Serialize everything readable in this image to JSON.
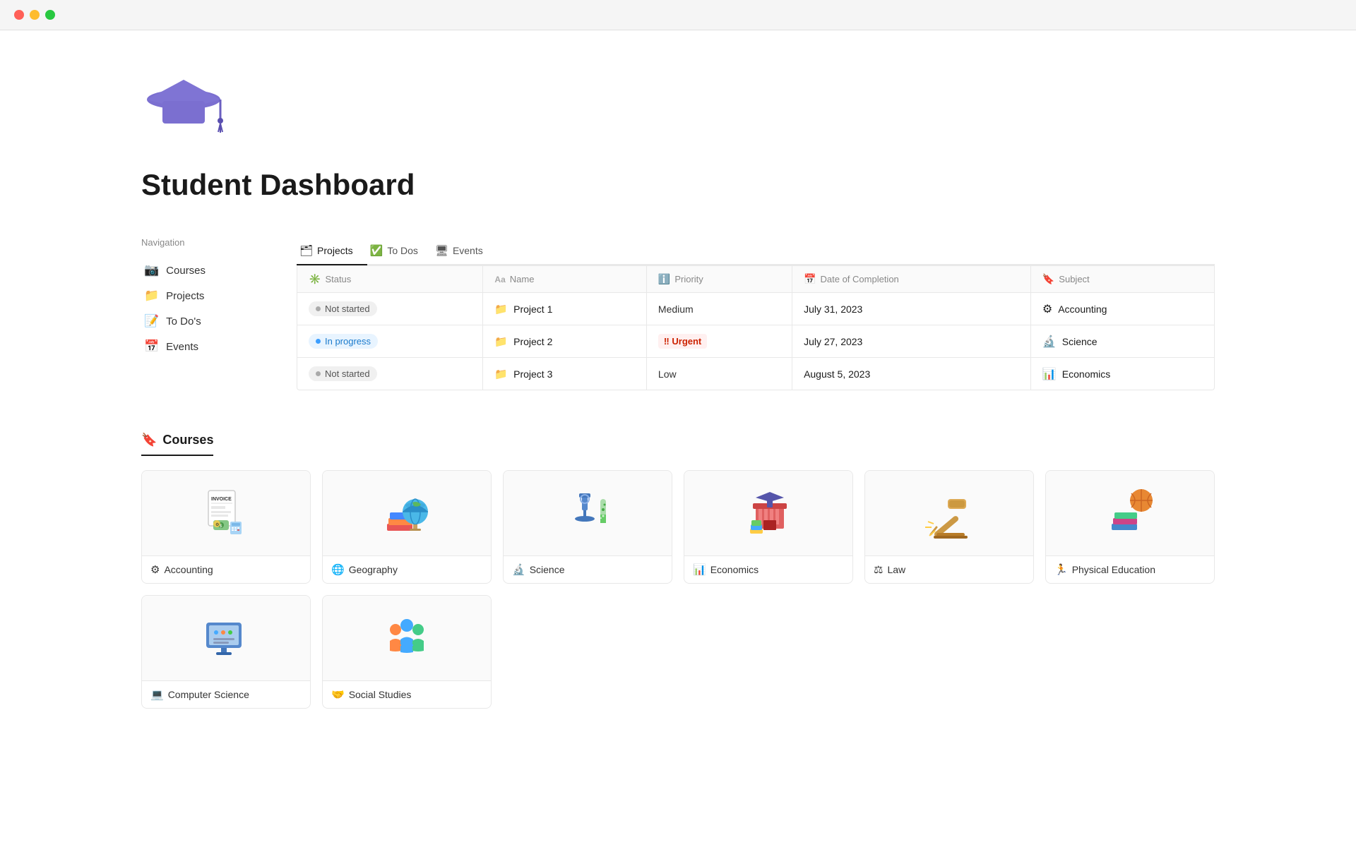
{
  "titleBar": {
    "buttons": [
      "red",
      "yellow",
      "green"
    ]
  },
  "header": {
    "logoAlt": "Graduation cap emoji",
    "title": "Student Dashboard"
  },
  "navigation": {
    "heading": "Navigation",
    "items": [
      {
        "id": "courses",
        "icon": "📷",
        "label": "Courses"
      },
      {
        "id": "projects",
        "icon": "📁",
        "label": "Projects"
      },
      {
        "id": "todos",
        "icon": "📝",
        "label": "To Do's"
      },
      {
        "id": "events",
        "icon": "📅",
        "label": "Events"
      }
    ]
  },
  "tabs": [
    {
      "id": "projects",
      "icon": "🗂",
      "label": "Projects",
      "active": true
    },
    {
      "id": "todos",
      "icon": "✅",
      "label": "To Dos",
      "active": false
    },
    {
      "id": "events",
      "icon": "🖥",
      "label": "Events",
      "active": false
    }
  ],
  "table": {
    "columns": [
      {
        "id": "status",
        "icon": "✳",
        "label": "Status"
      },
      {
        "id": "name",
        "icon": "Aa",
        "label": "Name"
      },
      {
        "id": "priority",
        "icon": "ℹ",
        "label": "Priority"
      },
      {
        "id": "dateCompletion",
        "icon": "📅",
        "label": "Date of Completion"
      },
      {
        "id": "subject",
        "icon": "🔖",
        "label": "Subject"
      }
    ],
    "rows": [
      {
        "status": "Not started",
        "statusType": "not-started",
        "name": "Project 1",
        "priority": "Medium",
        "priorityType": "medium",
        "date": "July 31, 2023",
        "subject": "Accounting",
        "subjectIcon": "⚙"
      },
      {
        "status": "In progress",
        "statusType": "in-progress",
        "name": "Project 2",
        "priority": "!! Urgent",
        "priorityType": "urgent",
        "date": "July 27, 2023",
        "subject": "Science",
        "subjectIcon": "🔬"
      },
      {
        "status": "Not started",
        "statusType": "not-started",
        "name": "Project 3",
        "priority": "Low",
        "priorityType": "low",
        "date": "August 5, 2023",
        "subject": "Economics",
        "subjectIcon": "📊"
      }
    ]
  },
  "coursesSection": {
    "heading": "Courses",
    "cards": [
      {
        "id": "accounting",
        "emoji": "🧾",
        "label": "Accounting",
        "labelIcon": "⚙"
      },
      {
        "id": "geography",
        "emoji": "🌍",
        "label": "Geography",
        "labelIcon": "🌐"
      },
      {
        "id": "science",
        "emoji": "🔬",
        "label": "Science",
        "labelIcon": "🔬"
      },
      {
        "id": "economics",
        "emoji": "🏛",
        "label": "Economics",
        "labelIcon": "📊"
      },
      {
        "id": "law",
        "emoji": "⚖",
        "label": "Law",
        "labelIcon": "⚖"
      },
      {
        "id": "physical-education",
        "emoji": "🏀",
        "label": "Physical Education",
        "labelIcon": "🏃"
      }
    ],
    "cardsRow2": [
      {
        "id": "computer-science",
        "emoji": "🖥",
        "label": "Computer Science",
        "labelIcon": "💻"
      },
      {
        "id": "social-studies",
        "emoji": "👥",
        "label": "Social Studies",
        "labelIcon": "🤝"
      }
    ]
  }
}
